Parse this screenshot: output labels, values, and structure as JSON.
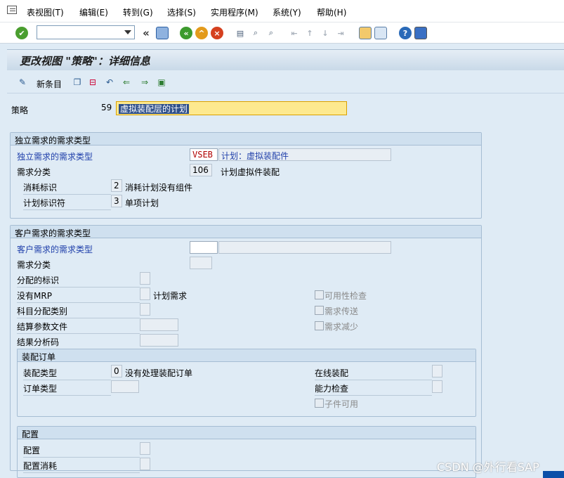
{
  "menubar": {
    "items": [
      "表视图(T)",
      "编辑(E)",
      "转到(G)",
      "选择(S)",
      "实用程序(M)",
      "系统(Y)",
      "帮助(H)"
    ]
  },
  "toolbar": {
    "command_value": "",
    "back_label": "«",
    "icons": [
      "enter-icon",
      "save-icon",
      "back-icon",
      "exit-icon",
      "cancel-icon",
      "print-icon",
      "find-icon",
      "find-next-icon",
      "first-page-icon",
      "previous-page-icon",
      "next-page-icon",
      "last-page-icon",
      "new-session-icon",
      "shortcut-icon",
      "help-icon",
      "layout-icon"
    ]
  },
  "title": "更改视图 \"策略\"：详细信息",
  "app_toolbar": {
    "new_entries_label": "新条目"
  },
  "strategy": {
    "label": "策略",
    "code": "59",
    "description": "虚拟装配层的计划"
  },
  "independent": {
    "section_title": "独立需求的需求类型",
    "req_type_label": "独立需求的需求类型",
    "req_type_value": "VSEB",
    "req_type_text": "计划：虚拟装配件",
    "req_class_label": "需求分类",
    "req_class_value": "106",
    "req_class_text": "计划虚拟件装配",
    "consumption_label": "消耗标识",
    "consumption_value": "2",
    "consumption_text": "消耗计划没有组件",
    "planning_label": "计划标识符",
    "planning_value": "3",
    "planning_text": "单项计划"
  },
  "customer": {
    "section_title": "客户需求的需求类型",
    "req_type_label": "客户需求的需求类型",
    "req_class_label": "需求分类",
    "allocation_label": "分配的标识",
    "no_mrp_label": "没有MRP",
    "no_mrp_text": "计划需求",
    "acct_assign_label": "科目分配类别",
    "settlement_label": "结算参数文件",
    "result_analysis_label": "结果分析码",
    "availability_label": "可用性检查",
    "req_transfer_label": "需求传送",
    "req_reduction_label": "需求减少"
  },
  "assembly": {
    "section_title": "装配订单",
    "type_label": "装配类型",
    "type_value": "0",
    "type_text": "没有处理装配订单",
    "order_type_label": "订单类型",
    "online_label": "在线装配",
    "capacity_label": "能力检查",
    "component_avail_label": "子件可用"
  },
  "config": {
    "section_title": "配置",
    "config_label": "配置",
    "config_consumption_label": "配置消耗"
  },
  "watermark": "CSDN @外行看SAP"
}
